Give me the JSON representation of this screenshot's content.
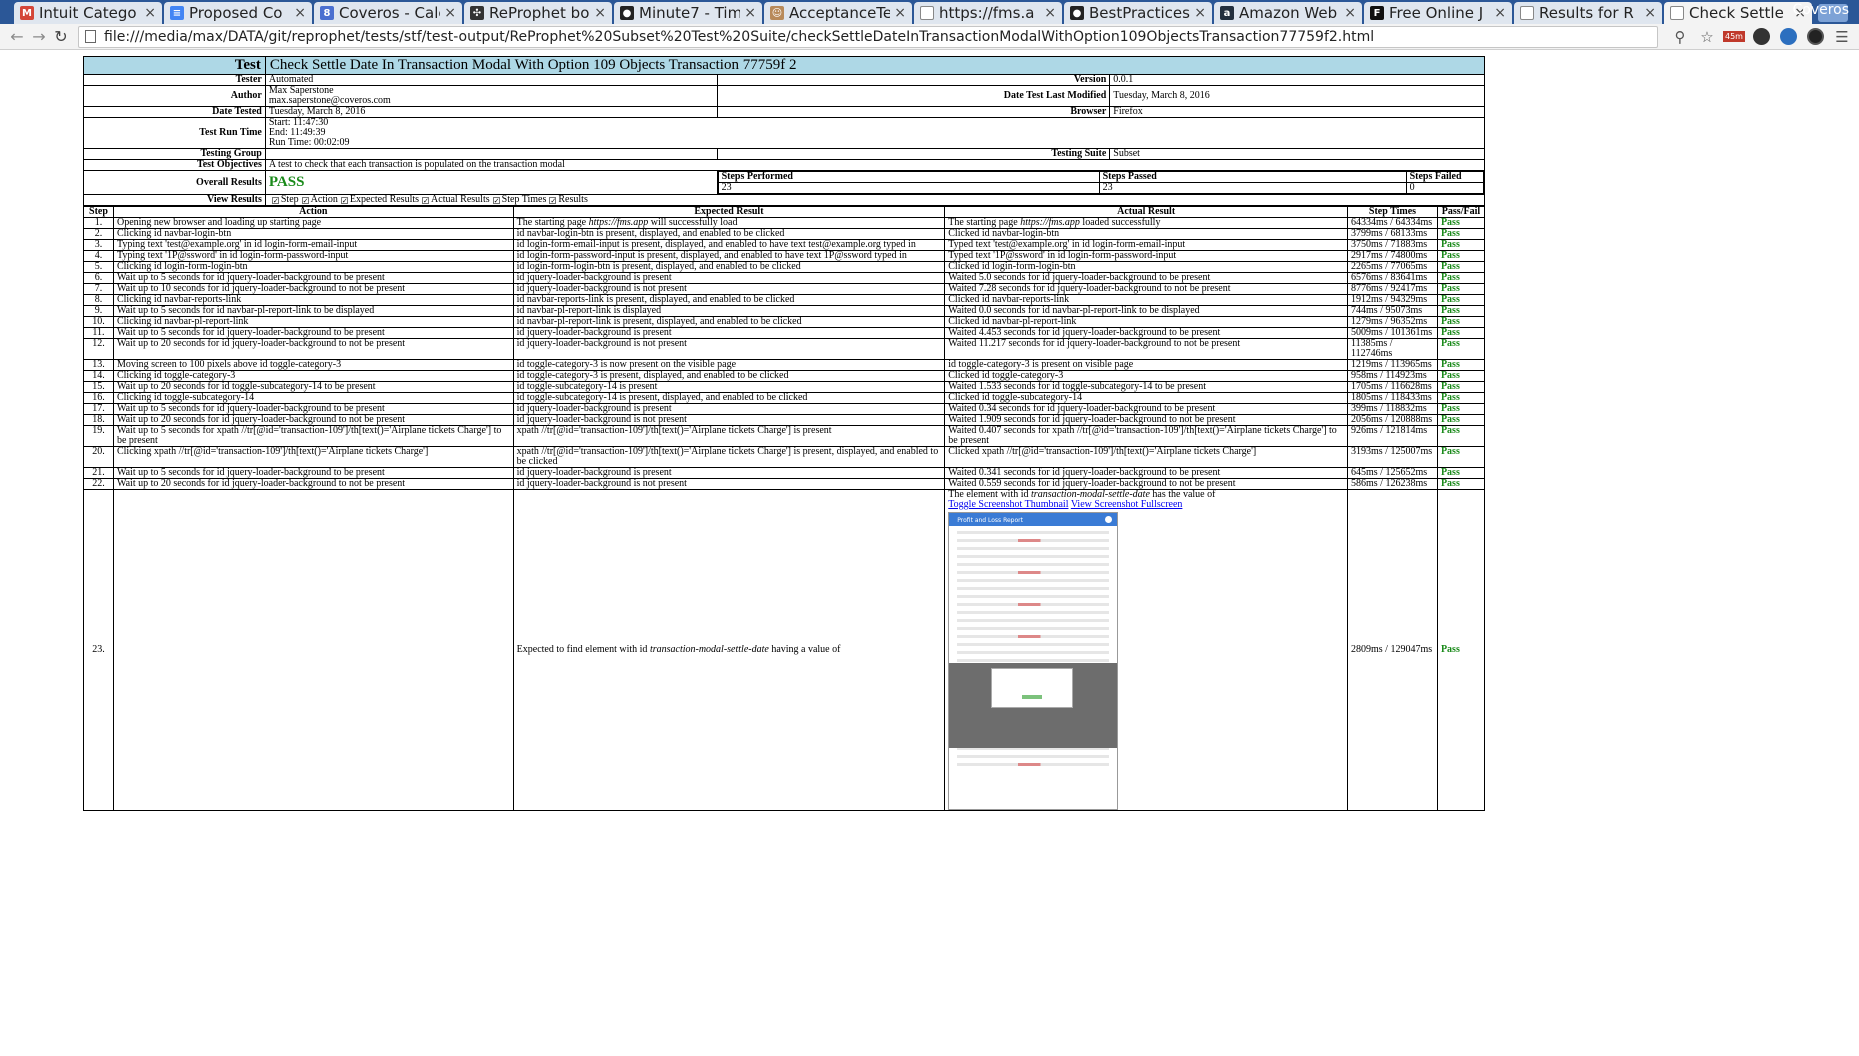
{
  "browser": {
    "tabs": [
      {
        "label": "Intuit Catego",
        "favicon": "gmail-icon",
        "color": "#d44638",
        "glyph": "M"
      },
      {
        "label": "Proposed Co",
        "favicon": "docs-icon",
        "color": "#4285f4",
        "glyph": "≡"
      },
      {
        "label": "Coveros - Cale",
        "favicon": "calendar-icon",
        "color": "#4a6fd0",
        "glyph": "8"
      },
      {
        "label": "ReProphet bo",
        "favicon": "reprophet-icon",
        "color": "#333333",
        "glyph": "✣"
      },
      {
        "label": "Minute7 - Tim",
        "favicon": "github-icon",
        "color": "#222222",
        "glyph": "●"
      },
      {
        "label": "AcceptanceTe",
        "favicon": "jenkins-icon",
        "color": "#b88a5a",
        "glyph": "☺"
      },
      {
        "label": "https://fms.a",
        "favicon": "page-icon",
        "color": "#999999",
        "glyph": ""
      },
      {
        "label": "BestPractices",
        "favicon": "github-icon",
        "color": "#222222",
        "glyph": "●"
      },
      {
        "label": "Amazon Web",
        "favicon": "amazon-icon",
        "color": "#232f3e",
        "glyph": "a"
      },
      {
        "label": "Free Online J",
        "favicon": "freeformatter-icon",
        "color": "#111111",
        "glyph": "F"
      },
      {
        "label": "Results for R",
        "favicon": "page-icon",
        "color": "#999999",
        "glyph": ""
      },
      {
        "label": "Check Settle I",
        "favicon": "page-icon",
        "color": "#999999",
        "glyph": ""
      }
    ],
    "profile_name": "Coveros",
    "url": "file:///media/max/DATA/git/reprophet/tests/stf/test-output/ReProphet%20Subset%20Test%20Suite/checkSettleDateInTransactionModalWithOption109ObjectsTransaction77759f2.html",
    "tab_close_glyph": "×",
    "extension_badge": "45m"
  },
  "report": {
    "header": {
      "label": "Test",
      "title": "Check Settle Date In Transaction Modal With Option 109 Objects Transaction 77759f 2"
    },
    "tester": {
      "label": "Tester",
      "value": "Automated"
    },
    "version": {
      "label": "Version",
      "value": "0.0.1"
    },
    "author": {
      "label": "Author",
      "name": "Max Saperstone",
      "email": "max.saperstone@coveros.com"
    },
    "last_modified": {
      "label": "Date Test Last Modified",
      "value": "Tuesday, March 8, 2016"
    },
    "date_tested": {
      "label": "Date Tested",
      "value": "Tuesday, March 8, 2016"
    },
    "browser": {
      "label": "Browser",
      "value": "Firefox"
    },
    "run_time": {
      "label": "Test Run Time",
      "start": "Start: 11:47:30",
      "end": "End: 11:49:39",
      "duration": "Run Time: 00:02:09"
    },
    "testing_group": {
      "label": "Testing Group",
      "value": ""
    },
    "testing_suite": {
      "label": "Testing Suite",
      "value": "Subset"
    },
    "objectives": {
      "label": "Test Objectives",
      "value": "A test to check that each transaction is populated on the transaction modal"
    },
    "overall": {
      "label": "Overall Results",
      "value": "PASS",
      "performed_label": "Steps Performed",
      "performed": "23",
      "passed_label": "Steps Passed",
      "passed": "23",
      "failed_label": "Steps Failed",
      "failed": "0"
    },
    "view_results": {
      "label": "View Results",
      "options": [
        "Step",
        "Action",
        "Expected Results",
        "Actual Results",
        "Step Times",
        "Results"
      ]
    },
    "columns": [
      "Step",
      "Action",
      "Expected Result",
      "Actual Result",
      "Step Times",
      "Pass/Fail"
    ],
    "steps": [
      {
        "n": "1.",
        "action": "Opening new browser and loading up starting page",
        "expected_pre": "The starting page ",
        "expected_em": "https://fms.app",
        "expected_post": " will successfully load",
        "actual_pre": "The starting page ",
        "actual_em": "https://fms.app",
        "actual_post": " loaded successfully",
        "time": "64334ms / 64334ms",
        "result": "Pass"
      },
      {
        "n": "2.",
        "action": "Clicking id navbar-login-btn",
        "expected": "id navbar-login-btn is present, displayed, and enabled to be clicked",
        "actual": "Clicked id navbar-login-btn",
        "time": "3799ms / 68133ms",
        "result": "Pass"
      },
      {
        "n": "3.",
        "action": "Typing text 'test@example.org' in id login-form-email-input",
        "expected": "id login-form-email-input is present, displayed, and enabled to have text test@example.org typed in",
        "actual": "Typed text 'test@example.org' in id login-form-email-input",
        "time": "3750ms / 71883ms",
        "result": "Pass"
      },
      {
        "n": "4.",
        "action": "Typing text '1P@ssword' in id login-form-password-input",
        "expected": "id login-form-password-input is present, displayed, and enabled to have text 1P@ssword typed in",
        "actual": "Typed text '1P@ssword' in id login-form-password-input",
        "time": "2917ms / 74800ms",
        "result": "Pass"
      },
      {
        "n": "5.",
        "action": "Clicking id login-form-login-btn",
        "expected": "id login-form-login-btn is present, displayed, and enabled to be clicked",
        "actual": "Clicked id login-form-login-btn",
        "time": "2265ms / 77065ms",
        "result": "Pass"
      },
      {
        "n": "6.",
        "action": "Wait up to 5 seconds for id jquery-loader-background to be present",
        "expected": "id jquery-loader-background is present",
        "actual": "Waited 5.0 seconds for id jquery-loader-background to be present",
        "time": "6576ms / 83641ms",
        "result": "Pass"
      },
      {
        "n": "7.",
        "action": "Wait up to 10 seconds for id jquery-loader-background to not be present",
        "expected": "id jquery-loader-background is not present",
        "actual": "Waited 7.28 seconds for id jquery-loader-background to not be present",
        "time": "8776ms / 92417ms",
        "result": "Pass"
      },
      {
        "n": "8.",
        "action": "Clicking id navbar-reports-link",
        "expected": "id navbar-reports-link is present, displayed, and enabled to be clicked",
        "actual": "Clicked id navbar-reports-link",
        "time": "1912ms / 94329ms",
        "result": "Pass"
      },
      {
        "n": "9.",
        "action": "Wait up to 5 seconds for id navbar-pl-report-link to be displayed",
        "expected": "id navbar-pl-report-link is displayed",
        "actual": "Waited 0.0 seconds for id navbar-pl-report-link to be displayed",
        "time": "744ms / 95073ms",
        "result": "Pass"
      },
      {
        "n": "10.",
        "action": "Clicking id navbar-pl-report-link",
        "expected": "id navbar-pl-report-link is present, displayed, and enabled to be clicked",
        "actual": "Clicked id navbar-pl-report-link",
        "time": "1279ms / 96352ms",
        "result": "Pass"
      },
      {
        "n": "11.",
        "action": "Wait up to 5 seconds for id jquery-loader-background to be present",
        "expected": "id jquery-loader-background is present",
        "actual": "Waited 4.453 seconds for id jquery-loader-background to be present",
        "time": "5009ms / 101361ms",
        "result": "Pass"
      },
      {
        "n": "12.",
        "action": "Wait up to 20 seconds for id jquery-loader-background to not be present",
        "expected": "id jquery-loader-background is not present",
        "actual": "Waited 11.217 seconds for id jquery-loader-background to not be present",
        "time": "11385ms / 112746ms",
        "result": "Pass"
      },
      {
        "n": "13.",
        "action": "Moving screen to 100 pixels above id toggle-category-3",
        "expected": "id toggle-category-3 is now present on the visible page",
        "actual": "id toggle-category-3 is present on visible page",
        "time": "1219ms / 113965ms",
        "result": "Pass"
      },
      {
        "n": "14.",
        "action": "Clicking id toggle-category-3",
        "expected": "id toggle-category-3 is present, displayed, and enabled to be clicked",
        "actual": "Clicked id toggle-category-3",
        "time": "958ms / 114923ms",
        "result": "Pass"
      },
      {
        "n": "15.",
        "action": "Wait up to 20 seconds for id toggle-subcategory-14 to be present",
        "expected": "id toggle-subcategory-14 is present",
        "actual": "Waited 1.533 seconds for id toggle-subcategory-14 to be present",
        "time": "1705ms / 116628ms",
        "result": "Pass"
      },
      {
        "n": "16.",
        "action": "Clicking id toggle-subcategory-14",
        "expected": "id toggle-subcategory-14 is present, displayed, and enabled to be clicked",
        "actual": "Clicked id toggle-subcategory-14",
        "time": "1805ms / 118433ms",
        "result": "Pass"
      },
      {
        "n": "17.",
        "action": "Wait up to 5 seconds for id jquery-loader-background to be present",
        "expected": "id jquery-loader-background is present",
        "actual": "Waited 0.34 seconds for id jquery-loader-background to be present",
        "time": "399ms / 118832ms",
        "result": "Pass"
      },
      {
        "n": "18.",
        "action": "Wait up to 20 seconds for id jquery-loader-background to not be present",
        "expected": "id jquery-loader-background is not present",
        "actual": "Waited 1.909 seconds for id jquery-loader-background to not be present",
        "time": "2056ms / 120888ms",
        "result": "Pass"
      },
      {
        "n": "19.",
        "action": "Wait up to 5 seconds for xpath //tr[@id='transaction-109']/th[text()='Airplane tickets Charge'] to be present",
        "expected": "xpath //tr[@id='transaction-109']/th[text()='Airplane tickets Charge'] is present",
        "actual": "Waited 0.407 seconds for xpath //tr[@id='transaction-109']/th[text()='Airplane tickets Charge'] to be present",
        "time": "926ms / 121814ms",
        "result": "Pass"
      },
      {
        "n": "20.",
        "action": "Clicking xpath //tr[@id='transaction-109']/th[text()='Airplane tickets Charge']",
        "expected": "xpath //tr[@id='transaction-109']/th[text()='Airplane tickets Charge'] is present, displayed, and enabled to be clicked",
        "actual": "Clicked xpath //tr[@id='transaction-109']/th[text()='Airplane tickets Charge']",
        "time": "3193ms / 125007ms",
        "result": "Pass"
      },
      {
        "n": "21.",
        "action": "Wait up to 5 seconds for id jquery-loader-background to be present",
        "expected": "id jquery-loader-background is present",
        "actual": "Waited 0.341 seconds for id jquery-loader-background to be present",
        "time": "645ms / 125652ms",
        "result": "Pass"
      },
      {
        "n": "22.",
        "action": "Wait up to 20 seconds for id jquery-loader-background to not be present",
        "expected": "id jquery-loader-background is not present",
        "actual": "Waited 0.559 seconds for id jquery-loader-background to not be present",
        "time": "586ms / 126238ms",
        "result": "Pass"
      }
    ],
    "last_step": {
      "n": "23.",
      "action": "",
      "expected_pre": "Expected to find element with id ",
      "expected_em": "transaction-modal-settle-date",
      "expected_post": " having a value of",
      "actual_pre": "The element with id ",
      "actual_em": "transaction-modal-settle-date",
      "actual_post": " has the value of",
      "toggle_link": "Toggle Screenshot Thumbnail",
      "fullscreen_link": "View Screenshot Fullscreen",
      "thumbnail_title": "Profit and Loss Report",
      "time": "2809ms / 129047ms",
      "result": "Pass"
    }
  },
  "colors": {
    "header_bg": "#aed8e6",
    "pass": "#1a8a1a",
    "tabbar": "#2b5797"
  }
}
